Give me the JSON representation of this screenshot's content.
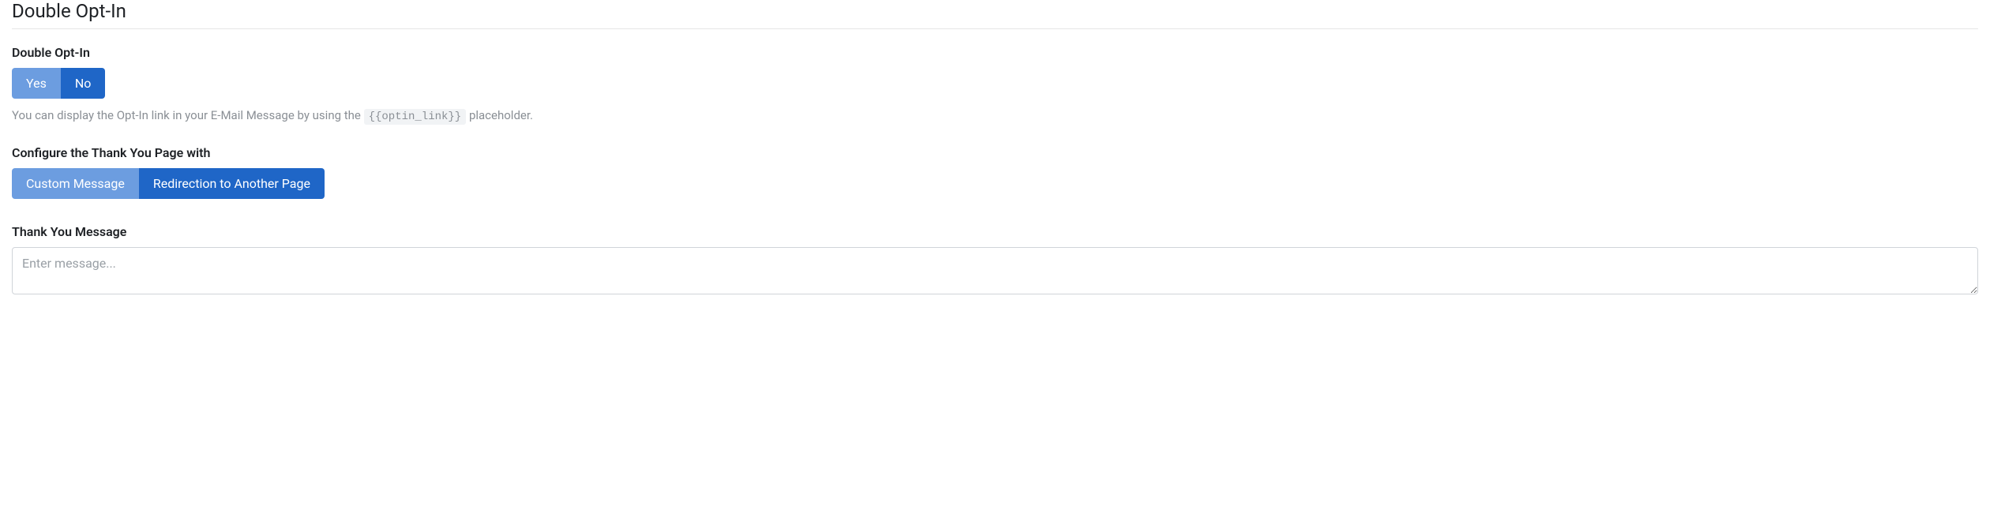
{
  "section": {
    "title": "Double Opt-In"
  },
  "opt_in": {
    "label": "Double Opt-In",
    "yes": "Yes",
    "no": "No",
    "help_pre": "You can display the Opt-In link in your E-Mail Message by using the ",
    "help_code": "{{optin_link}}",
    "help_post": " placeholder."
  },
  "thank_you_config": {
    "label": "Configure the Thank You Page with",
    "custom": "Custom Message",
    "redirect": "Redirection to Another Page"
  },
  "thank_you_message": {
    "label": "Thank You Message",
    "placeholder": "Enter message...",
    "value": ""
  }
}
